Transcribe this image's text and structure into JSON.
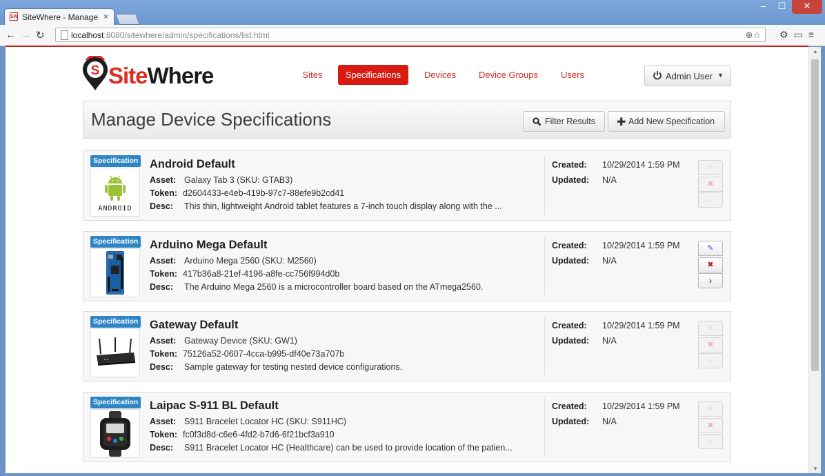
{
  "browser": {
    "tab_title": "SiteWhere - Manage",
    "tab_close": "×",
    "favicon_text": "SW",
    "url_host": "localhost",
    "url_path": ":8080/sitewhere/admin/specifications/list.html",
    "window_controls": {
      "minimize": "–",
      "maximize": "☐",
      "close": "✕"
    }
  },
  "brand": {
    "part1": "Site",
    "part2": "Where"
  },
  "nav": {
    "items": [
      {
        "label": "Sites",
        "active": false
      },
      {
        "label": "Specifications",
        "active": true
      },
      {
        "label": "Devices",
        "active": false
      },
      {
        "label": "Device Groups",
        "active": false
      },
      {
        "label": "Users",
        "active": false
      }
    ],
    "user_label": "Admin User",
    "active_color": "#d91a10"
  },
  "page": {
    "title": "Manage Device Specifications",
    "filter_label": "Filter Results",
    "add_label": "Add New Specification"
  },
  "labels": {
    "badge": "Specification",
    "asset": "Asset:",
    "token": "Token:",
    "desc": "Desc:",
    "created": "Created:",
    "updated": "Updated:"
  },
  "specifications": [
    {
      "name": "Android Default",
      "asset": "Galaxy Tab 3 (SKU: GTAB3)",
      "token": "d2604433-e4eb-419b-97c7-88efe9b2cd41",
      "desc": "This thin, lightweight Android tablet features a 7-inch touch display along with the ...",
      "created": "10/29/2014 1:59 PM",
      "updated": "N/A",
      "actions_enabled": false,
      "thumb_icon": "android-logo",
      "thumb_caption": "ANDROID"
    },
    {
      "name": "Arduino Mega Default",
      "asset": "Arduino Mega 2560 (SKU: M2560)",
      "token": "417b36a8-21ef-4196-a8fe-cc756f994d0b",
      "desc": "The Arduino Mega 2560 is a microcontroller board based on the ATmega2560.",
      "created": "10/29/2014 1:59 PM",
      "updated": "N/A",
      "actions_enabled": true,
      "thumb_icon": "arduino-board-image"
    },
    {
      "name": "Gateway Default",
      "asset": "Gateway Device (SKU: GW1)",
      "token": "75126a52-0607-4cca-b995-df40e73a707b",
      "desc": "Sample gateway for testing nested device configurations.",
      "created": "10/29/2014 1:59 PM",
      "updated": "N/A",
      "actions_enabled": false,
      "thumb_icon": "gateway-router-image"
    },
    {
      "name": "Laipac S-911 BL Default",
      "asset": "S911 Bracelet Locator HC (SKU: S911HC)",
      "token": "fc0f3d8d-c6e6-4fd2-b7d6-6f21bcf3a910",
      "desc": "S911 Bracelet Locator HC (Healthcare) can be used to provide location of the patien...",
      "created": "10/29/2014 1:59 PM",
      "updated": "N/A",
      "actions_enabled": false,
      "thumb_icon": "bracelet-locator-image"
    }
  ],
  "icons": {
    "edit": "edit-icon",
    "delete": "delete-icon",
    "open": "chevron-right-icon",
    "search": "search-icon",
    "add": "plus-icon",
    "power": "power-icon"
  }
}
